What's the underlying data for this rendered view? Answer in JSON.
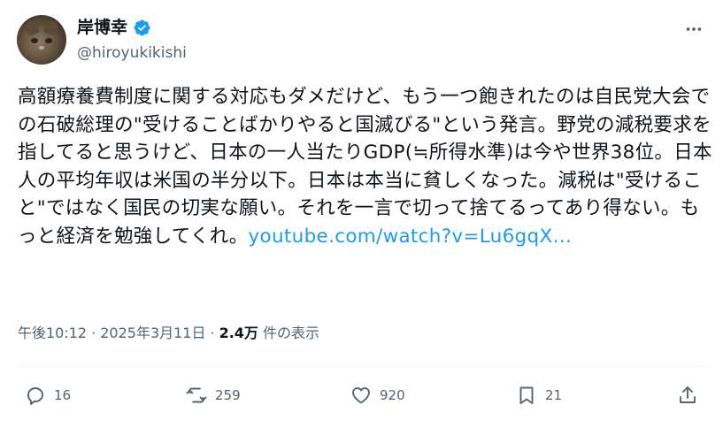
{
  "author": {
    "display_name": "岸博幸",
    "handle": "@hiroyukikishi",
    "verified": true,
    "avatar_icon": "cat-avatar"
  },
  "tweet": {
    "text": "高額療養費制度に関する対応もダメだけど、もう一つ飽きれたのは自民党大会での石破総理の\"受けることばかりやると国滅びる\"という発言。野党の減税要求を指してると思うけど、日本の一人当たりGDP(≒所得水準)は今や世界38位。日本人の平均年収は米国の半分以下。日本は本当に貧しくなった。減税は\"受けること\"ではなく国民の切実な願い。それを一言で切って捨てるってあり得ない。もっと経済を勉強してくれ。",
    "link_text": "youtube.com/watch?v=Lu6gqX…"
  },
  "meta": {
    "time": "午後10:12",
    "separator": "·",
    "date": "2025年3月11日",
    "views_count": "2.4万",
    "views_label": "件の表示"
  },
  "actions": {
    "reply_count": "16",
    "retweet_count": "259",
    "like_count": "920",
    "bookmark_count": "21"
  },
  "colors": {
    "text": "#0f1419",
    "secondary": "#536471",
    "link": "#1d9bf0",
    "verified": "#1d9bf0"
  },
  "icons": {
    "more": "more-icon",
    "reply": "reply-icon",
    "retweet": "retweet-icon",
    "like": "heart-icon",
    "bookmark": "bookmark-icon",
    "share": "share-icon"
  }
}
